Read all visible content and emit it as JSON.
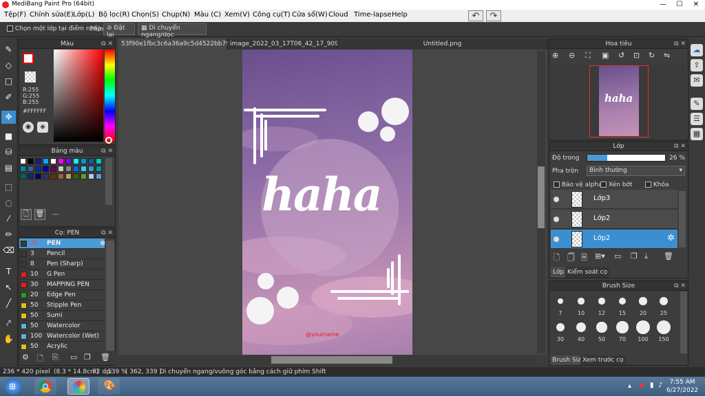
{
  "window": {
    "title": "MediBang Paint Pro (64bit)",
    "min": "—",
    "max": "☐",
    "close": "✕"
  },
  "menu": [
    "Tệp(F)",
    "Chỉnh sửa(E)",
    "Lớp(L)",
    "Bộ lọc(R)",
    "Chọn(S)",
    "Chụp(N)",
    "Màu (C)",
    "Xem(V)",
    "Công cụ(T)",
    "Cửa sổ(W)",
    "Cloud",
    "Time-lapse",
    "Help"
  ],
  "toolbar": {
    "select_layer_label": "Chọn một lớp tại điểm nhấp",
    "phim_label": "Phím",
    "reset_label": "Đặt lại",
    "move_label": "Di chuyển ngang/dọc"
  },
  "color_panel": {
    "title": "Màu",
    "r": "R:255",
    "g": "G:255",
    "b": "B:255",
    "hex": "#FFFFFF"
  },
  "palette_panel": {
    "title": "Bảng màu",
    "dash": "---",
    "swatches": [
      "#ffffff",
      "#000000",
      "#1a1a8c",
      "#00aaff",
      "#ffffff",
      "#ff00ff",
      "#8800ff",
      "#00ffff",
      "#0099cc",
      "#006699",
      "#00cccc",
      "#0088aa",
      "#336699",
      "#003399",
      "#0000aa",
      "#660066",
      "#cccccc",
      "#888888",
      "#0066ff",
      "#33ccff",
      "#3399cc",
      "#0099aa",
      "#006666",
      "#003366",
      "#000066",
      "#333366",
      "#663300",
      "#996633",
      "#cc9966",
      "#336600",
      "#669933",
      "#aaccee",
      "#6699cc"
    ]
  },
  "brush_panel": {
    "title": "Cọ: PEN",
    "items": [
      {
        "size": "25",
        "name": "PEN",
        "color": "#3a3a3a"
      },
      {
        "size": "3",
        "name": "Pencil",
        "color": "#3a3a3a"
      },
      {
        "size": "8",
        "name": "Pen (Sharp)",
        "color": "#3a3a3a"
      },
      {
        "size": "10",
        "name": "G Pen",
        "color": "#e02020"
      },
      {
        "size": "30",
        "name": "MAPPING PEN",
        "color": "#e02020"
      },
      {
        "size": "20",
        "name": "Edge Pen",
        "color": "#20a020"
      },
      {
        "size": "50",
        "name": "Stipple Pen",
        "color": "#e0c020"
      },
      {
        "size": "50",
        "name": "Sumi",
        "color": "#e0c020"
      },
      {
        "size": "50",
        "name": "Watercolor",
        "color": "#60b0e0"
      },
      {
        "size": "100",
        "name": "Watercolor (Wet)",
        "color": "#60b0e0"
      },
      {
        "size": "50",
        "name": "Acrylic",
        "color": "#e0c020"
      }
    ]
  },
  "tabs": [
    "53f90e1fbc3c6a36a9c5d4522bb79fef.jpg",
    "image_2022_03_17T06_42_17_909Z.png",
    "Untitled.png"
  ],
  "artwork": {
    "main_text": "haha",
    "watermark": "@yourname"
  },
  "navigator": {
    "title": "Hoa tiêu",
    "mini_text": "haha"
  },
  "layer_panel": {
    "title": "Lớp",
    "opacity_label": "Độ trong",
    "opacity_value": "26 %",
    "opacity_fraction": 0.26,
    "blend_label": "Pha trộn",
    "blend_value": "Bình thường",
    "protect_alpha": "Bảo vệ alpha",
    "clipping": "Xén bớt",
    "lock": "Khóa",
    "layers": [
      "Lớp3",
      "Lớp2",
      "Lớp2"
    ],
    "tab_layer": "Lớp",
    "tab_brush_control": "Kiểm soát cọ"
  },
  "brush_size_panel": {
    "title": "Brush Size",
    "sizes": [
      "7",
      "10",
      "12",
      "15",
      "20",
      "25",
      "30",
      "40",
      "50",
      "70",
      "100",
      "150"
    ],
    "tab_size": "Brush Size",
    "tab_preview": "Xem trước cọ"
  },
  "status": {
    "dimensions": "236 * 420 pixel",
    "cm": "(8.3 * 14.8cm)",
    "dpi": "72 dpi",
    "zoom": "139 %",
    "coords": "( 362, 339 )",
    "hint": "Di chuyển ngang/vuông góc bằng cách giữ phím Shift"
  },
  "taskbar": {
    "time": "7:55 AM",
    "date": "6/27/2022"
  }
}
